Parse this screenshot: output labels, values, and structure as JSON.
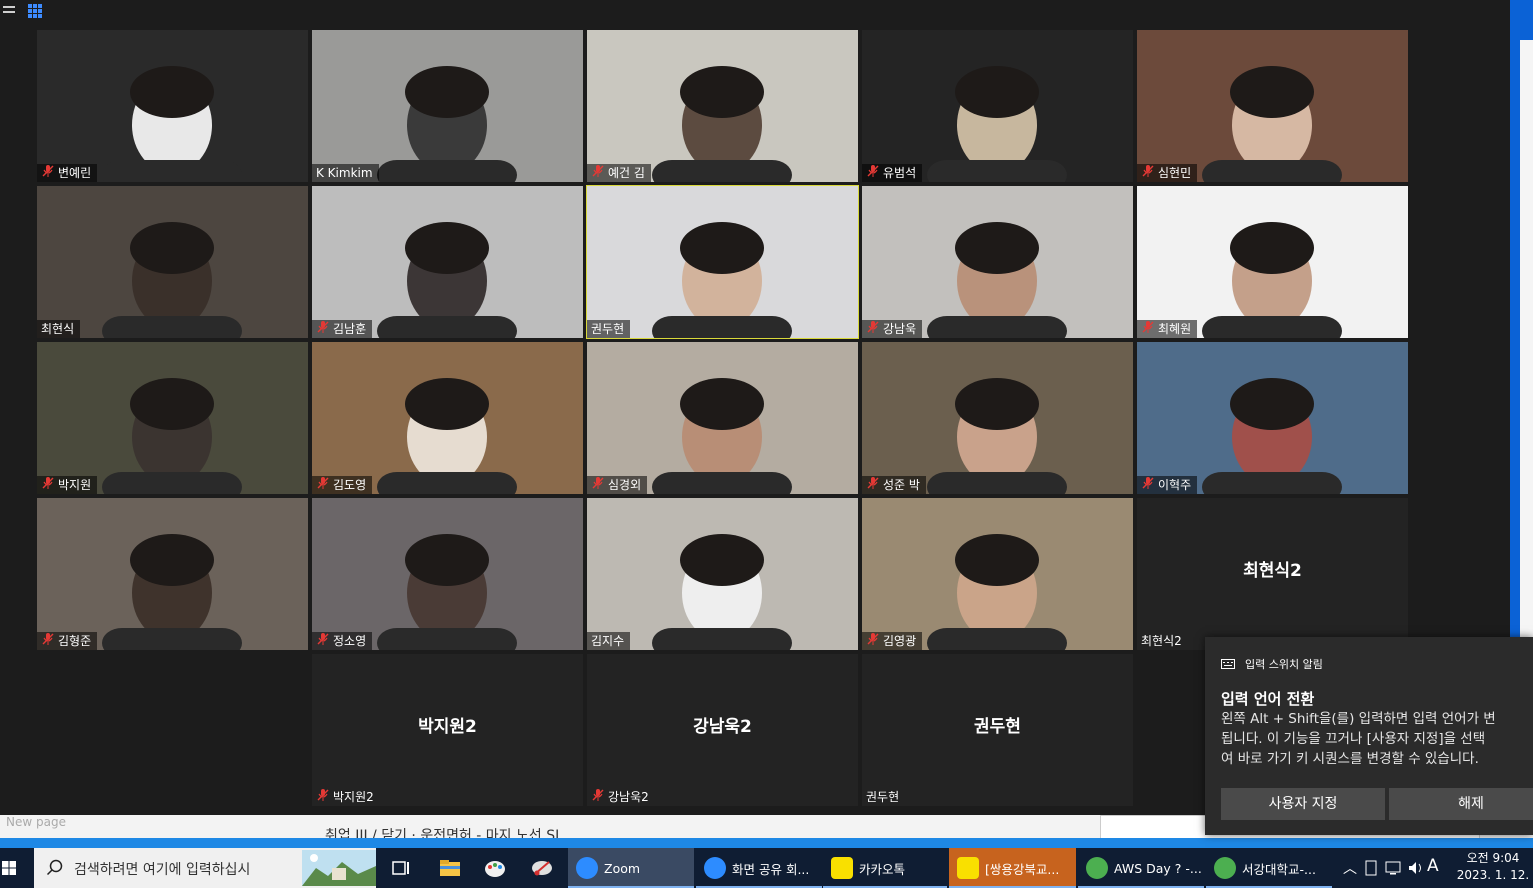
{
  "window": {
    "app": "Zoom",
    "participants": [
      {
        "name": "변예린",
        "muted": true,
        "bg": "#2a2a2a",
        "face": "#e8e8e8"
      },
      {
        "name": "K Kimkim",
        "muted": false,
        "bg": "#9a9a98",
        "face": "#3a3a3a"
      },
      {
        "name": "예건 김",
        "muted": true,
        "bg": "#c9c7bf",
        "face": "#5c4b40"
      },
      {
        "name": "유범석",
        "muted": true,
        "bg": "#242424",
        "face": "#c7b79e"
      },
      {
        "name": "심현민",
        "muted": true,
        "bg": "#6c4a3b",
        "face": "#d6b8a3"
      },
      {
        "name": "최현식",
        "muted": false,
        "bg": "#4d4640",
        "face": "#3a302a"
      },
      {
        "name": "김남훈",
        "muted": true,
        "bg": "#bdbdbd",
        "face": "#3c3636"
      },
      {
        "name": "권두현",
        "muted": false,
        "bg": "#d9d9db",
        "face": "#d2b39c",
        "active": true
      },
      {
        "name": "강남욱",
        "muted": true,
        "bg": "#c2c0bd",
        "face": "#b9927b"
      },
      {
        "name": "최혜원",
        "muted": true,
        "bg": "#f2f2f2",
        "face": "#c4a08a"
      },
      {
        "name": "박지원",
        "muted": true,
        "bg": "#4a4a3c",
        "face": "#3b3430"
      },
      {
        "name": "김도영",
        "muted": true,
        "bg": "#8a6a4b",
        "face": "#e6dcd0"
      },
      {
        "name": "심경외",
        "muted": true,
        "bg": "#b4aca1",
        "face": "#b88e76"
      },
      {
        "name": "성준 박",
        "muted": true,
        "bg": "#6b5f4e",
        "face": "#c9a28b"
      },
      {
        "name": "이혁주",
        "muted": true,
        "bg": "#4f6c8a",
        "face": "#a0504b"
      },
      {
        "name": "김형준",
        "muted": true,
        "bg": "#6b625a",
        "face": "#3f332c"
      },
      {
        "name": "정소영",
        "muted": true,
        "bg": "#6b6668",
        "face": "#4a3b36"
      },
      {
        "name": "김지수",
        "muted": false,
        "bg": "#bdb9b2",
        "face": "#eeeeee"
      },
      {
        "name": "김영광",
        "muted": true,
        "bg": "#9a8a72",
        "face": "#caa489"
      },
      {
        "name": "최현식2",
        "muted": false,
        "dark": true,
        "center": "최현식2"
      },
      {
        "name": "박지원2",
        "muted": true,
        "dark": true,
        "center": "박지원2"
      },
      {
        "name": "강남욱2",
        "muted": true,
        "dark": true,
        "center": "강남욱2"
      },
      {
        "name": "권두현",
        "muted": false,
        "dark": true,
        "center": "권두현"
      }
    ]
  },
  "background_page": {
    "old_text": "New page",
    "line_text": "취업 III / 닫기 · 운전면허 - 마지 노선 SL"
  },
  "toast": {
    "header": "입력 스위치 알림",
    "title": "입력 언어 전환",
    "body_lines": [
      "왼쪽 Alt + Shift을(를) 입력하면 입력 언어가 변",
      "됩니다. 이 기능을 끄거나 [사용자 지정]을 선택",
      "여 바로 가기 키 시퀀스를 변경할 수 있습니다."
    ],
    "button_customize": "사용자 지정",
    "button_dismiss": "해제"
  },
  "taskbar": {
    "search_placeholder": "검색하려면 여기에 입력하십시",
    "apps": [
      {
        "label": "Zoom",
        "icon": "zoom-icon",
        "color": "#2d8cff"
      },
      {
        "label": "화면 공유 회...",
        "icon": "zoom-icon",
        "color": "#2d8cff"
      },
      {
        "label": "카카오톡",
        "icon": "kakaotalk-icon",
        "color": "#f9e000"
      },
      {
        "label": "[쌍용강북교...",
        "icon": "kakaotalk-icon",
        "color": "#f9e000"
      },
      {
        "label": "AWS Day ? -...",
        "icon": "chrome-icon",
        "color": "#4caf50"
      },
      {
        "label": "서강대학교-...",
        "icon": "chrome-icon",
        "color": "#4caf50"
      }
    ],
    "ime": "A",
    "time": "오전 9:04",
    "date": "2023. 1. 12."
  }
}
